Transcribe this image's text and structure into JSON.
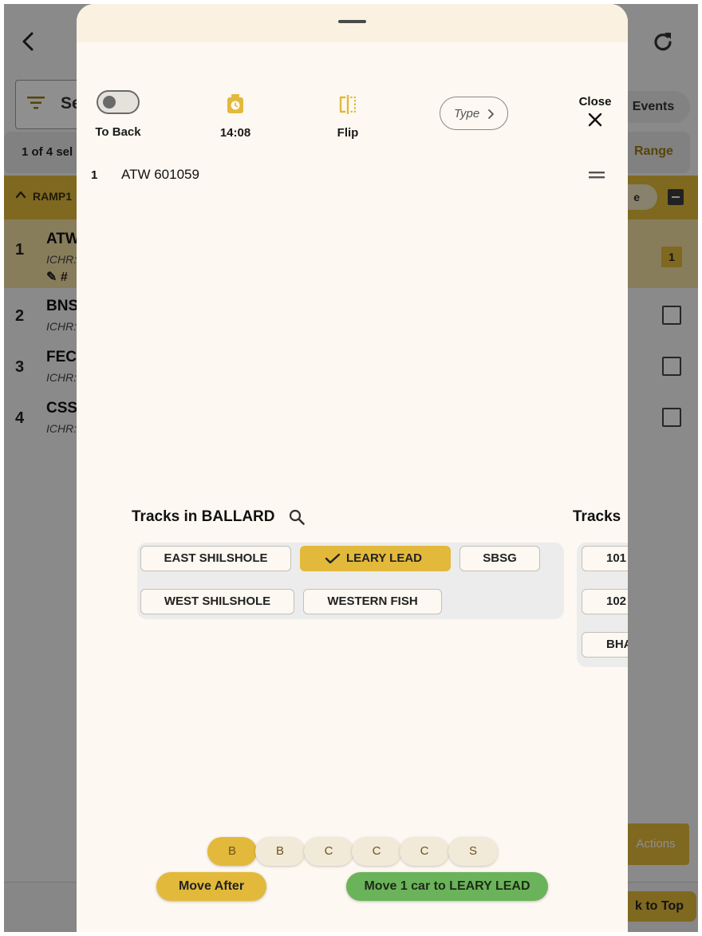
{
  "background": {
    "search_label": "Se",
    "events_label": "Events",
    "selection_count": "1 of 4 sel",
    "range_label": "Range",
    "group_label": "RAMP1",
    "group_pill_label": "e",
    "rows": [
      {
        "num": "1",
        "name": "ATW",
        "sub": "ICHR:",
        "extra": "✎ #",
        "badge": "1"
      },
      {
        "num": "2",
        "name": "BNS",
        "sub": "ICHR:"
      },
      {
        "num": "3",
        "name": "FEC",
        "sub": "ICHR:"
      },
      {
        "num": "4",
        "name": "CSS",
        "sub": "ICHR:"
      }
    ],
    "actions_label": "Actions",
    "to_top_label": "k to Top"
  },
  "sheet": {
    "toolbar": {
      "to_back_label": "To Back",
      "to_back_on": false,
      "time_label": "14:08",
      "flip_label": "Flip",
      "type_label": "Type",
      "close_label": "Close"
    },
    "car": {
      "num": "1",
      "name": "ATW 601059"
    },
    "tracks": {
      "title": "Tracks in BALLARD",
      "chips": [
        {
          "label": "EAST SHILSHOLE",
          "selected": false
        },
        {
          "label": "LEARY LEAD",
          "selected": true
        },
        {
          "label": "SBSG",
          "selected": false
        },
        {
          "label": "WEST SHILSHOLE",
          "selected": false
        },
        {
          "label": "WESTERN FISH",
          "selected": false
        }
      ],
      "second_title": "Tracks",
      "second_chips": [
        "101",
        "102",
        "BHA"
      ]
    },
    "position_options": [
      {
        "label": "B",
        "active": true
      },
      {
        "label": "B",
        "active": false
      },
      {
        "label": "C",
        "active": false
      },
      {
        "label": "C",
        "active": false
      },
      {
        "label": "C",
        "active": false
      },
      {
        "label": "S",
        "active": false
      }
    ],
    "move_after_label": "Move After",
    "move_car_label": "Move 1 car to LEARY LEAD"
  },
  "colors": {
    "accent_gold": "#e2b93a",
    "confirm_green": "#6bb35a",
    "sheet_bg": "#fdf8f1"
  },
  "icons": [
    "back-arrow-icon",
    "refresh-icon",
    "filter-icon",
    "chevron-up-icon",
    "minus-icon",
    "pencil-icon",
    "timer-icon",
    "flip-icon",
    "chevron-right-icon",
    "close-icon",
    "drag-handle-icon",
    "search-icon",
    "checkmark-icon"
  ]
}
